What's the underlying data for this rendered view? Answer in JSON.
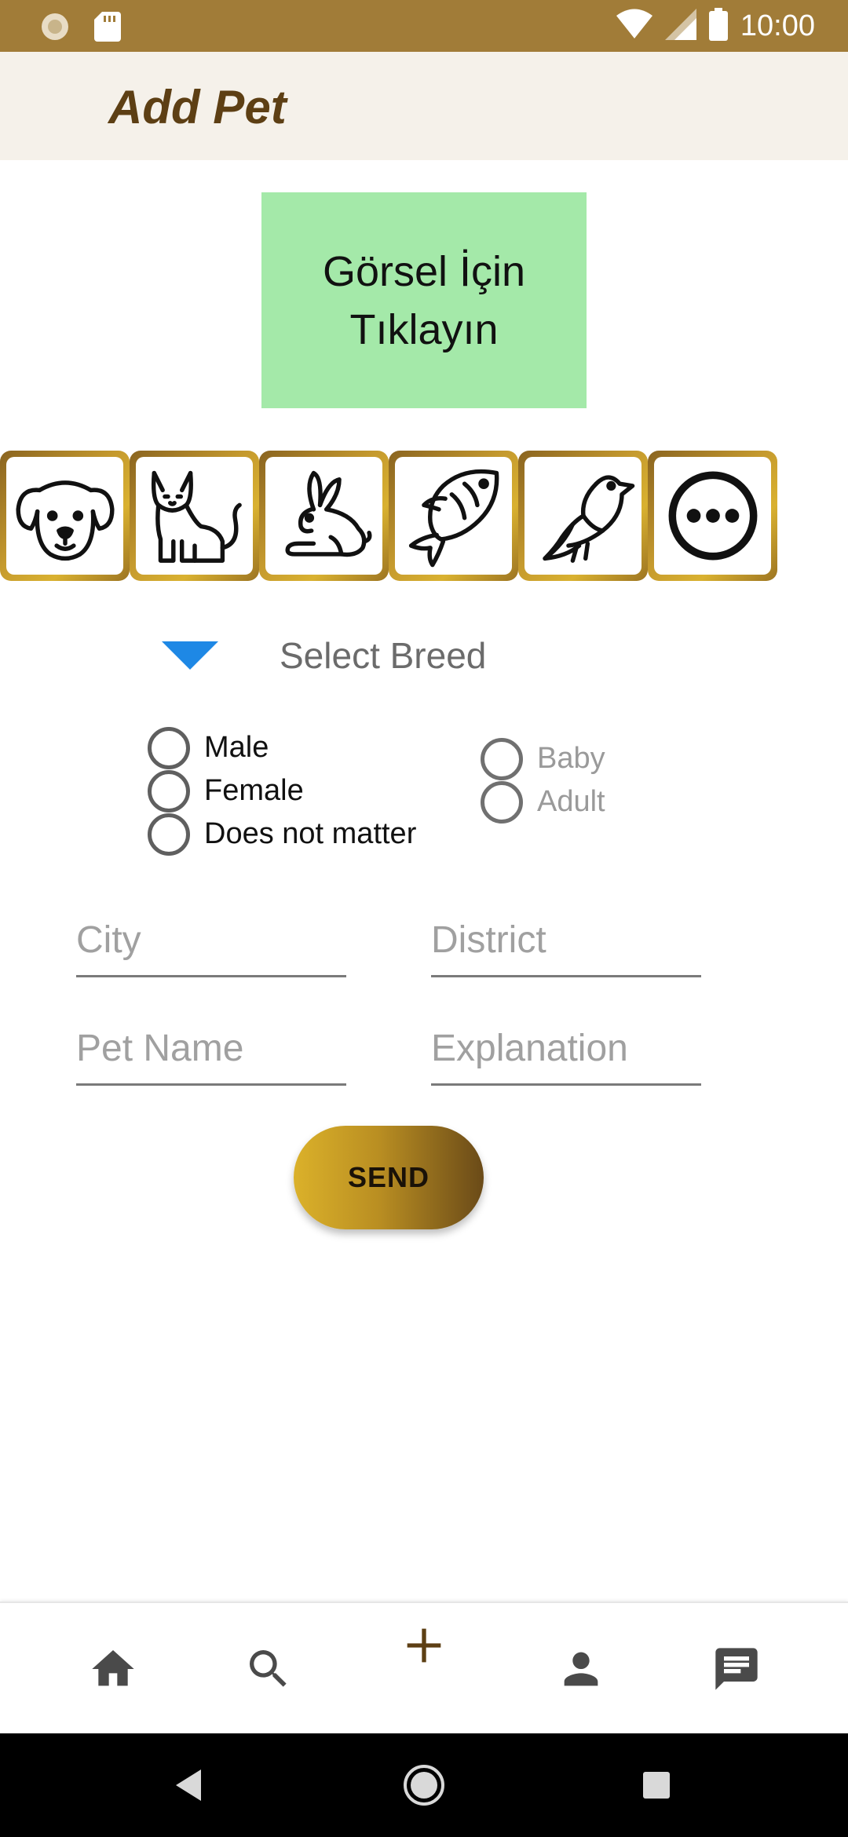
{
  "status_bar": {
    "time": "10:00",
    "icons": [
      "sun-notification-icon",
      "sd-card-icon",
      "wifi-icon",
      "cellular-signal-icon",
      "battery-icon"
    ]
  },
  "app_bar": {
    "title": "Add Pet"
  },
  "image_picker": {
    "label": "Görsel İçin\nTıklayın"
  },
  "categories": [
    "dog-icon",
    "cat-icon",
    "rabbit-icon",
    "fish-icon",
    "bird-icon",
    "more-icon"
  ],
  "breed": {
    "placeholder": "Select Breed"
  },
  "gender": {
    "options": [
      "Male",
      "Female",
      "Does not matter"
    ]
  },
  "age": {
    "options": [
      "Baby",
      "Adult"
    ]
  },
  "fields": {
    "city": {
      "placeholder": "City",
      "value": ""
    },
    "district": {
      "placeholder": "District",
      "value": ""
    },
    "pet_name": {
      "placeholder": "Pet Name",
      "value": ""
    },
    "explanation": {
      "placeholder": "Explanation",
      "value": ""
    }
  },
  "send_button": {
    "label": "SEND"
  },
  "bottom_nav": {
    "items": [
      "home-icon",
      "search-icon",
      "add-icon",
      "profile-icon",
      "messages-icon"
    ]
  },
  "system_nav": {
    "items": [
      "back-icon",
      "home-circle-icon",
      "recents-icon"
    ]
  },
  "colors": {
    "status_bar": "#a17c38",
    "app_bar_bg": "#f5f1ea",
    "title_text": "#5d3f14",
    "image_box": "#a4e9a9",
    "breed_arrow": "#1e88e5",
    "gold_light": "#dbb12a",
    "gold_dark": "#6a4a18"
  }
}
